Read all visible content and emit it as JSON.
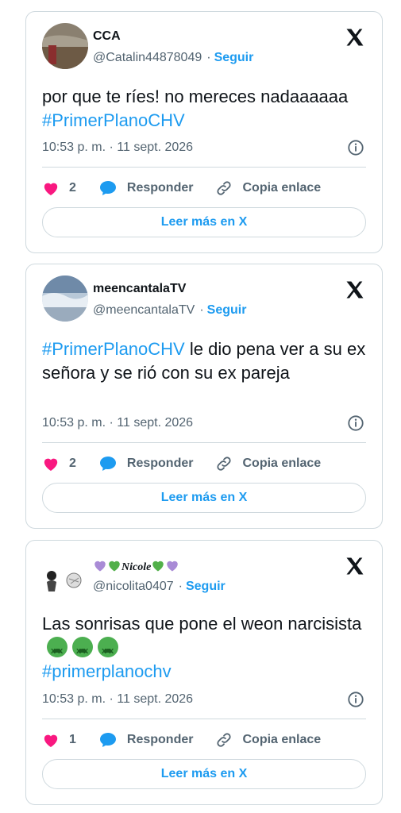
{
  "tweets": [
    {
      "name": "CCA",
      "handle": "@Catalin44878049",
      "follow": "Seguir",
      "text_plain": "por que te ríes! no mereces nadaaaaaa ",
      "text_hashtag": "#PrimerPlanoCHV",
      "time": "10:53 p. m. · 11 sept. 2026",
      "likes": "2",
      "reply": "Responder",
      "copy": "Copia enlace",
      "read_more": "Leer más en X"
    },
    {
      "name": "meencantalaTV",
      "handle": "@meencantalaTV",
      "follow": "Seguir",
      "text_hashtag": "#PrimerPlanoCHV",
      "text_plain": " le dio pena ver a su ex señora y se rió con su ex pareja",
      "time": "10:53 p. m. · 11 sept. 2026",
      "likes": "2",
      "reply": "Responder",
      "copy": "Copia enlace",
      "read_more": "Leer más en X"
    },
    {
      "name": "Nicole",
      "handle": "@nicolita0407",
      "follow": "Seguir",
      "text_plain": "Las sonrisas que pone el weon narcisista",
      "text_hashtag": "#primerplanochv",
      "time": "10:53 p. m. · 11 sept. 2026",
      "likes": "1",
      "reply": "Responder",
      "copy": "Copia enlace",
      "read_more": "Leer más en X"
    }
  ],
  "colors": {
    "link": "#1d9bf0",
    "secondary": "#536471",
    "border": "#cfd9de",
    "heart": "#f91880"
  }
}
